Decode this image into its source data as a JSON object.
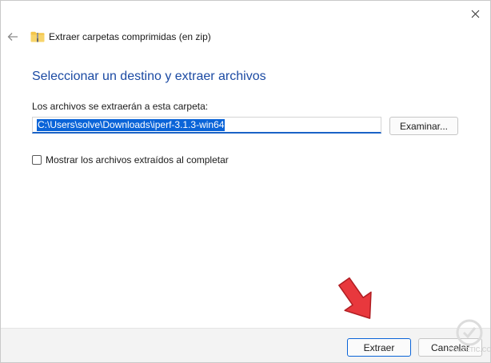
{
  "window": {
    "title": "Extraer carpetas comprimidas (en zip)",
    "close_icon": "close-icon",
    "back_icon": "back-arrow-icon",
    "title_icon": "zip-folder-icon"
  },
  "content": {
    "heading": "Seleccionar un destino y extraer archivos",
    "destination_label": "Los archivos se extraerán a esta carpeta:",
    "path_value": "C:\\Users\\solve\\Downloads\\iperf-3.1.3-win64",
    "browse_label": "Examinar...",
    "show_files_label": "Mostrar los archivos extraídos al completar",
    "show_files_checked": false
  },
  "footer": {
    "extract_label": "Extraer",
    "cancel_label": "Cancelar"
  },
  "annotation": {
    "arrow_icon": "red-arrow-icon",
    "arrow_color": "#e8383d"
  },
  "watermark": {
    "text": "SOLVETIC.COM"
  },
  "colors": {
    "heading": "#1b4aa3",
    "selection": "#0a64d8",
    "footer_bg": "#f3f3f3"
  }
}
